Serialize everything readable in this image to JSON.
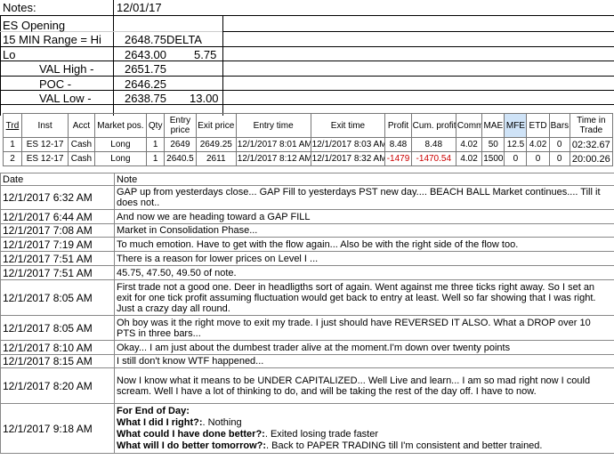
{
  "notes": {
    "label": "Notes:",
    "date": "12/01/17"
  },
  "levels": {
    "title": "ES Opening",
    "range_label": "15 MIN Range = Hi",
    "hi": "2648.75",
    "delta_label": "DELTA",
    "lo_label": "Lo",
    "lo": "2643.00",
    "delta": "5.75",
    "val_high_label": "VAL High  -",
    "val_high": "2651.75",
    "poc_label": "POC  -",
    "poc": "2646.25",
    "val_low_label": "VAL Low  -",
    "val_low": "2638.75",
    "val_diff": "13.00"
  },
  "trades": {
    "headers": [
      "Trd",
      "Inst",
      "Acct",
      "Market pos.",
      "Qty",
      "Entry price",
      "Exit price",
      "Entry time",
      "Exit time",
      "Profit",
      "Cum. profit",
      "Comm",
      "MAE",
      "MFE",
      "ETD",
      "Bars",
      "Time in Trade"
    ],
    "rows": [
      [
        "1",
        "ES 12-17",
        "Cash",
        "Long",
        "1",
        "2649",
        "2649.25",
        "12/1/2017 8:01 AM",
        "12/1/2017 8:03 AM",
        "8.48",
        "8.48",
        "4.02",
        "50",
        "12.5",
        "4.02",
        "0",
        "02:32.67"
      ],
      [
        "2",
        "ES 12-17",
        "Cash",
        "Long",
        "1",
        "2640.5",
        "2611",
        "12/1/2017 8:12 AM",
        "12/1/2017 8:32 AM",
        "-1479",
        "-1470.54",
        "4.02",
        "1500",
        "0",
        "0",
        "0",
        "20:00.26"
      ]
    ]
  },
  "journal": {
    "headers": [
      "Date",
      "Note"
    ],
    "rows": [
      {
        "date": "12/1/2017 6:32 AM",
        "note": "GAP up from yesterdays close... GAP Fill to yesterdays PST new day.... BEACH BALL Market continues.... Till it does not.."
      },
      {
        "date": "12/1/2017 6:44 AM",
        "note": "And now we are heading toward a GAP FILL"
      },
      {
        "date": "12/1/2017 7:08 AM",
        "note": "Market in Consolidation Phase..."
      },
      {
        "date": "12/1/2017 7:19 AM",
        "note": "To much emotion.  Have to get with the flow again... Also be with the right side of the flow too."
      },
      {
        "date": "12/1/2017 7:51 AM",
        "note": "There is a reason for lower prices on Level I ..."
      },
      {
        "date": "12/1/2017 7:51 AM",
        "note": "45.75, 47.50, 49.50 of note."
      },
      {
        "date": "12/1/2017 8:05 AM",
        "note": "First trade not a good one.  Deer in headligths sort of again.  Went against me three ticks right away.  So I set an exit for one tick profit assuming fluctuation would get back to entry at least.  Well so far showing that I was right.  Just a crazy day all round."
      },
      {
        "date": "12/1/2017 8:05 AM",
        "note": "Oh boy was it the right move to exit my trade.  I just should have REVERSED IT ALSO.   What a DROP over 10 PTS in three bars..."
      },
      {
        "date": "12/1/2017 8:10 AM",
        "note": "Okay... I am just about the dumbest trader alive at the moment.I'm down over twenty points"
      },
      {
        "date": "12/1/2017 8:15 AM",
        "note": "I still don't know WTF happened..."
      },
      {
        "date": "12/1/2017 8:20 AM",
        "note": "Now I know what it means to be UNDER CAPITALIZED... Well Live and learn... I am so mad right now I could scream.  Well I have a lot of thinking to do, and will be taking the rest of the day off.  I have to now."
      }
    ],
    "last": {
      "date": "12/1/2017 9:18 AM",
      "l1": "For End of Day:",
      "q1": "What I did I right?:",
      "a1": ". Nothing",
      "q2": "What could I have done better?:",
      "a2": ". Exited losing trade faster",
      "q3": "What will I do better tomorrow?:",
      "a3": ".  Back to PAPER TRADING till I'm consistent and better trained."
    }
  }
}
